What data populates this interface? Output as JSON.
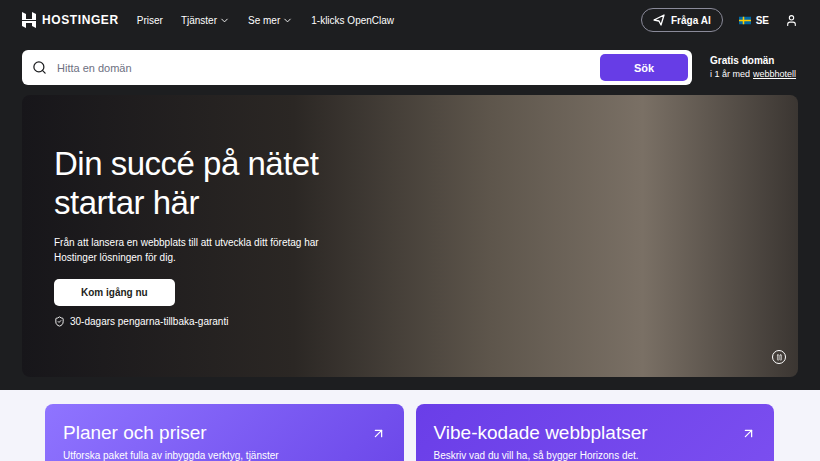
{
  "header": {
    "logo": "HOSTINGER",
    "nav": [
      {
        "label": "Priser",
        "dropdown": false
      },
      {
        "label": "Tjänster",
        "dropdown": true
      },
      {
        "label": "Se mer",
        "dropdown": true
      },
      {
        "label": "1-klicks OpenClaw",
        "dropdown": false
      }
    ],
    "ask_ai": "Fråga AI",
    "language": "SE"
  },
  "search": {
    "placeholder": "Hitta en domän",
    "button": "Sök"
  },
  "promo": {
    "title": "Gratis domän",
    "text": "i 1 år med",
    "link": "webbhotell"
  },
  "hero": {
    "title": "Din succé på nätet startar här",
    "text": "Från att lansera en webbplats till att utveckla ditt företag har Hostinger lösningen för dig.",
    "button": "Kom igång nu",
    "guarantee": "30-dagars pengarna-tillbaka-garanti"
  },
  "cards": [
    {
      "title": "Planer och priser",
      "text": "Utforska paket fulla av inbyggda verktyg, tjänster"
    },
    {
      "title": "Vibe-kodade webbplatser",
      "text": "Beskriv vad du vill ha, så bygger Horizons det."
    }
  ]
}
